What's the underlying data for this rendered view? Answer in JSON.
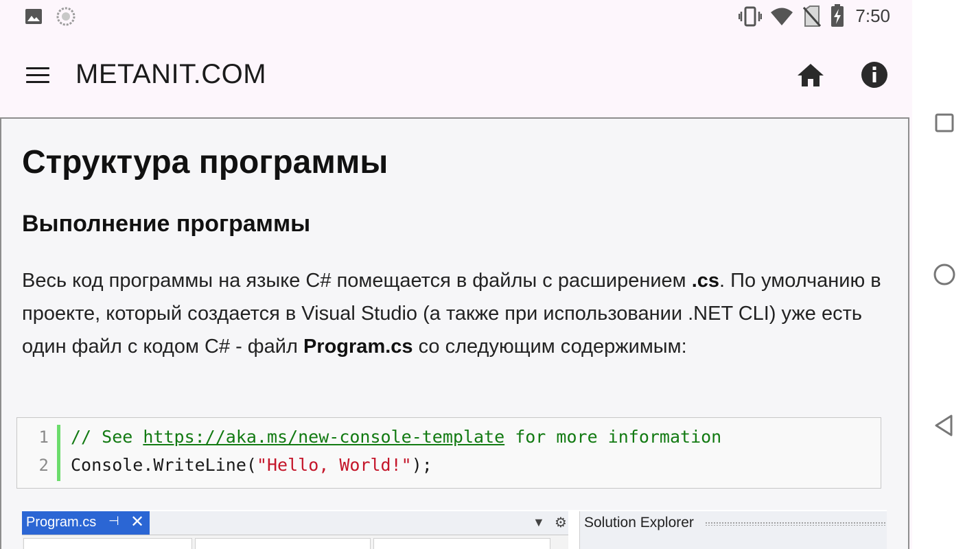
{
  "status_bar": {
    "time": "7:50",
    "left_icons": [
      "image-icon",
      "sync-icon"
    ],
    "right_icons": [
      "vibrate-icon",
      "wifi-icon",
      "no-sim-icon",
      "battery-charging-icon"
    ]
  },
  "app_bar": {
    "title": "METANIT.COM",
    "menu_icon": "menu-icon",
    "home_icon": "home-icon",
    "info_icon": "info-icon"
  },
  "article": {
    "title": "Структура программы",
    "section": "Выполнение программы",
    "paragraph": {
      "part1": "Весь код программы на языке C# помещается в файлы с расширением ",
      "ext": ".cs",
      "part2": ". По умолчанию в проекте, который создается в Visual Studio (а также при использовании .NET CLI) уже есть один файл с кодом C# - файл ",
      "file": "Program.cs",
      "part3": " со следующим содержимым:"
    },
    "code": {
      "line_numbers": [
        "1",
        "2"
      ],
      "line1_comment_start": "// See ",
      "line1_link": "https://aka.ms/new-console-template",
      "line1_comment_end": " for more information",
      "line2_prefix": "Console.WriteLine(",
      "line2_string": "\"Hello, World!\"",
      "line2_suffix": ");"
    },
    "screenshot": {
      "tab_label": "Program.cs",
      "tab_pin": "⊣",
      "tab_close": "✕",
      "panel_title": "Solution Explorer"
    }
  },
  "nav_bar": {
    "icons": [
      "recents-icon",
      "home-circle-icon",
      "back-icon"
    ]
  },
  "colors": {
    "app_background": "#fdf6fc",
    "code_comment": "#127a12",
    "code_string": "#c4162a",
    "gutter_bar": "#6cdc6c",
    "vs_tab": "#2b66d4"
  }
}
